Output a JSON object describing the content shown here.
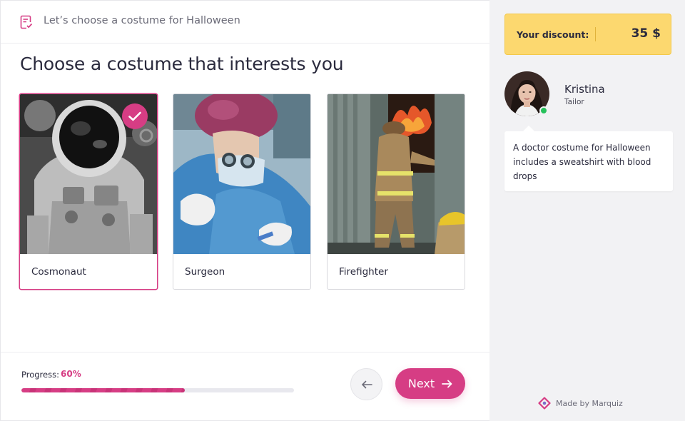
{
  "header": {
    "title": "Let’s choose a costume for Halloween",
    "icon": "checklist-icon"
  },
  "question": "Choose a costume that interests you",
  "options": [
    {
      "label": "Cosmonaut",
      "selected": true
    },
    {
      "label": "Surgeon",
      "selected": false
    },
    {
      "label": "Firefighter",
      "selected": false
    }
  ],
  "progress": {
    "label": "Progress:",
    "value": "60%",
    "fraction": 0.6
  },
  "buttons": {
    "next_label": "Next",
    "back_icon": "arrow-left-icon",
    "next_icon": "arrow-right-icon"
  },
  "discount": {
    "label": "Your discount:",
    "value": "35 $"
  },
  "agent": {
    "name": "Kristina",
    "role": "Tailor",
    "message": "A doctor costume for Halloween includes a sweatshirt with blood drops"
  },
  "branding": {
    "made_by": "Made by Marquiz"
  },
  "colors": {
    "accent": "#d63d84",
    "discount_bg": "#fcd86f",
    "online": "#26c15a"
  }
}
